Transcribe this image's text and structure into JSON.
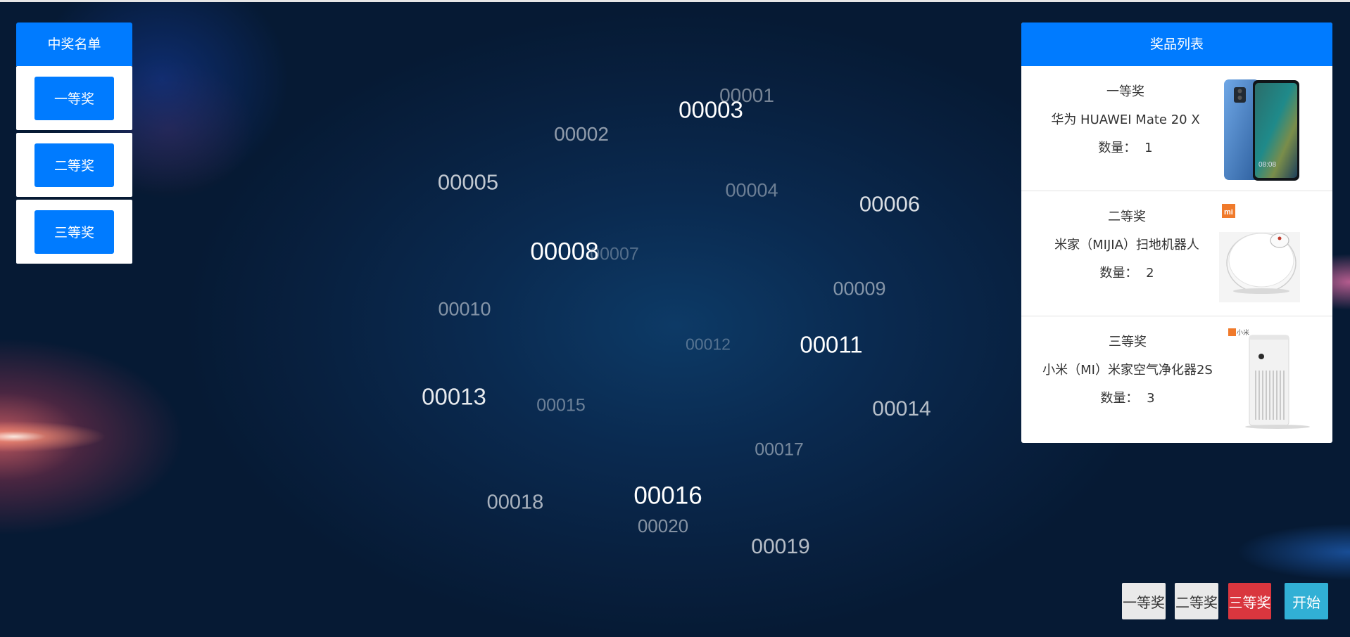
{
  "winners_panel": {
    "title": "中奖名单",
    "levels": [
      {
        "label": "一等奖"
      },
      {
        "label": "二等奖"
      },
      {
        "label": "三等奖"
      }
    ]
  },
  "prize_panel": {
    "title": "奖品列表",
    "prizes": [
      {
        "level": "一等奖",
        "name": "华为 HUAWEI Mate 20 X",
        "quantity_label": "数量：",
        "quantity": "1",
        "image": "phone-image"
      },
      {
        "level": "二等奖",
        "name": "米家（MIJIA）扫地机器人",
        "quantity_label": "数量：",
        "quantity": "2",
        "image": "robot-vacuum-image",
        "brand_mark": "mi"
      },
      {
        "level": "三等奖",
        "name": "小米（MI）米家空气净化器2S",
        "quantity_label": "数量：",
        "quantity": "3",
        "image": "air-purifier-image",
        "brand_mark": "小米"
      }
    ]
  },
  "lottery_numbers": [
    {
      "text": "00001",
      "opacity": 0.45,
      "size": 28
    },
    {
      "text": "00003",
      "opacity": 1.0,
      "size": 33
    },
    {
      "text": "00002",
      "opacity": 0.55,
      "size": 28
    },
    {
      "text": "00005",
      "opacity": 0.75,
      "size": 31
    },
    {
      "text": "00004",
      "opacity": 0.4,
      "size": 27
    },
    {
      "text": "00006",
      "opacity": 0.85,
      "size": 31
    },
    {
      "text": "00008",
      "opacity": 1.0,
      "size": 35
    },
    {
      "text": "00007",
      "opacity": 0.3,
      "size": 25
    },
    {
      "text": "00009",
      "opacity": 0.5,
      "size": 27
    },
    {
      "text": "00010",
      "opacity": 0.5,
      "size": 27
    },
    {
      "text": "00012",
      "opacity": 0.3,
      "size": 23
    },
    {
      "text": "00011",
      "opacity": 1.0,
      "size": 33
    },
    {
      "text": "00013",
      "opacity": 0.9,
      "size": 33
    },
    {
      "text": "00015",
      "opacity": 0.4,
      "size": 25
    },
    {
      "text": "00014",
      "opacity": 0.7,
      "size": 30
    },
    {
      "text": "00017",
      "opacity": 0.45,
      "size": 25
    },
    {
      "text": "00018",
      "opacity": 0.65,
      "size": 29
    },
    {
      "text": "00016",
      "opacity": 1.0,
      "size": 35
    },
    {
      "text": "00020",
      "opacity": 0.5,
      "size": 26
    },
    {
      "text": "00019",
      "opacity": 0.7,
      "size": 30
    }
  ],
  "controls": {
    "first_prize": "一等奖",
    "second_prize": "二等奖",
    "third_prize": "三等奖",
    "start": "开始"
  },
  "colors": {
    "primary": "#007bff",
    "danger": "#d9363e",
    "info": "#31b0d5",
    "light": "#e9e9e9"
  }
}
